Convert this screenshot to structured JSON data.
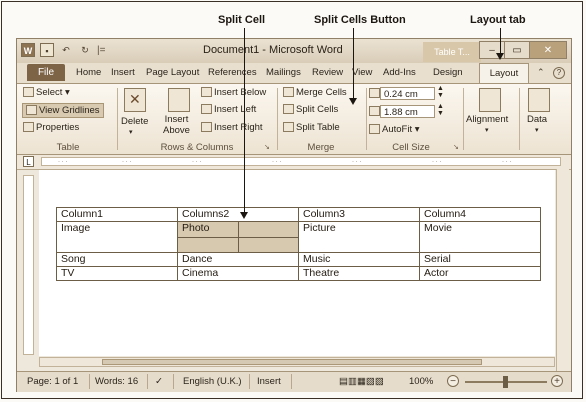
{
  "callouts": {
    "split_cell": "Split  Cell",
    "split_cells_button": "Split Cells Button",
    "layout_tab": "Layout tab"
  },
  "window": {
    "title": "Document1  -  Microsoft Word",
    "context_title": "Table T...",
    "qat_icons": [
      "word-icon",
      "save-icon",
      "undo-icon",
      "redo-icon"
    ]
  },
  "tabs": {
    "file": "File",
    "items": [
      "Home",
      "Insert",
      "Page Layout",
      "References",
      "Mailings",
      "Review",
      "View",
      "Add-Ins",
      "Design",
      "Layout"
    ],
    "controls": [
      "⌃",
      "?"
    ]
  },
  "ribbon": {
    "table": {
      "select": "Select ▾",
      "view_gridlines": "View Gridlines",
      "properties": "Properties",
      "label": "Table"
    },
    "rows_columns": {
      "delete": "Delete",
      "insert_above": "Insert\nAbove",
      "insert_below": "Insert Below",
      "insert_left": "Insert Left",
      "insert_right": "Insert Right",
      "label": "Rows & Columns"
    },
    "merge": {
      "merge_cells": "Merge Cells",
      "split_cells": "Split Cells",
      "split_table": "Split Table",
      "label": "Merge"
    },
    "cell_size": {
      "height": "0.24 cm",
      "width": "1.88 cm",
      "autofit": "AutoFit ▾",
      "label": "Cell Size"
    },
    "alignment": "Alignment",
    "data": "Data"
  },
  "ruler": {
    "corner": "L"
  },
  "table": {
    "rows": [
      [
        "Column1",
        "Columns2",
        "",
        "Column3",
        "Column4"
      ],
      [
        "Image",
        "Photo",
        "",
        "Picture",
        "Movie"
      ],
      [
        "Song",
        "Dance",
        "",
        "Music",
        "Serial"
      ],
      [
        "TV",
        "Cinema",
        "",
        "Theatre",
        "Actor"
      ]
    ]
  },
  "statusbar": {
    "page": "Page: 1 of 1",
    "words": "Words: 16",
    "language": "English (U.K.)",
    "mode": "Insert",
    "zoom": "100%",
    "zoom_level": 100
  }
}
